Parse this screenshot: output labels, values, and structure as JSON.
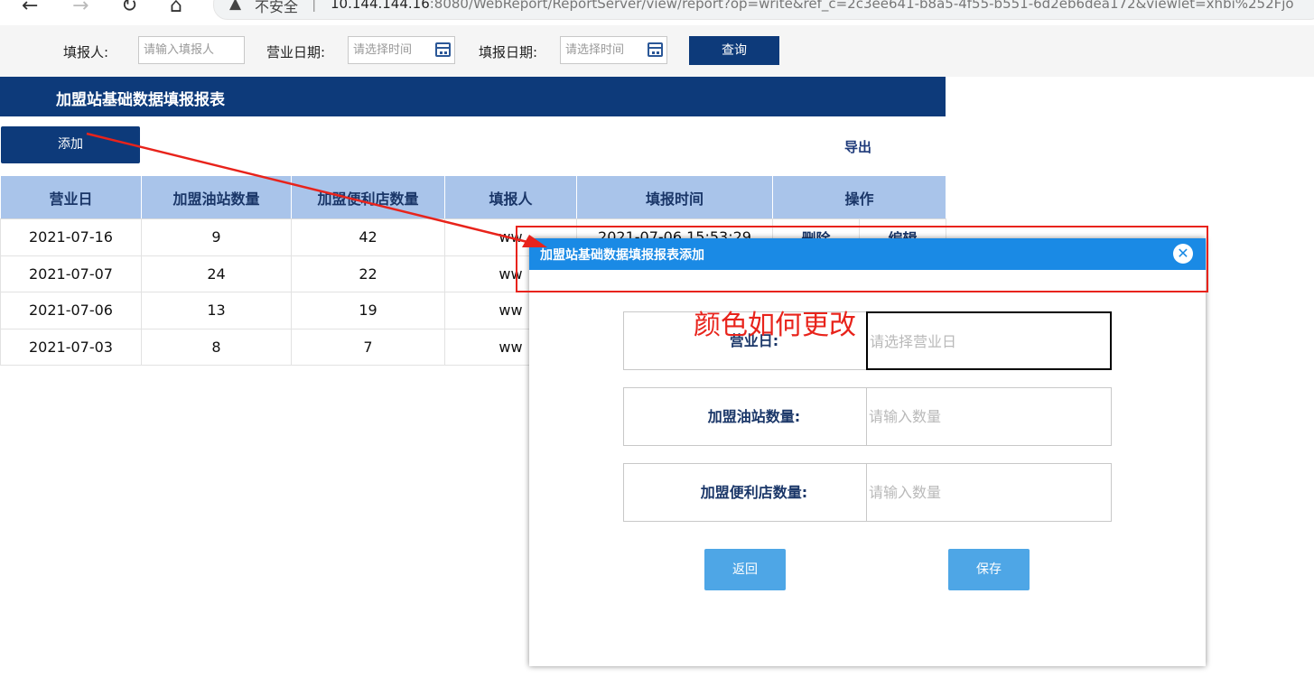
{
  "browser": {
    "back_icon": "←",
    "forward_icon": "→",
    "reload_icon": "↻",
    "home_icon": "⌂",
    "warning_icon": "▲",
    "insecure_label": "不安全",
    "separator": "|",
    "url_host": "10.144.144.16",
    "url_rest": ":8080/WebReport/ReportServer/view/report?op=write&ref_c=2c3ee641-b8a5-4f55-b551-6d2eb6dea172&viewlet=xhbi%252Fjo"
  },
  "filters": {
    "reporter_label": "填报人:",
    "reporter_placeholder": "请输入填报人",
    "business_date_label": "营业日期:",
    "business_date_placeholder": "请选择时间",
    "report_date_label": "填报日期:",
    "report_date_placeholder": "请选择时间",
    "query_label": "查询"
  },
  "report": {
    "title": "加盟站基础数据填报报表",
    "add_label": "添加",
    "export_label": "导出",
    "columns": [
      "营业日",
      "加盟油站数量",
      "加盟便利店数量",
      "填报人",
      "填报时间",
      "操作"
    ],
    "rows": [
      {
        "date": "2021-07-16",
        "stations": "9",
        "stores": "42",
        "reporter": "ww",
        "time": "2021-07-06 15:53:29",
        "delete": "删除",
        "edit": "编辑"
      },
      {
        "date": "2021-07-07",
        "stations": "24",
        "stores": "22",
        "reporter": "ww",
        "time": "",
        "delete": "",
        "edit": ""
      },
      {
        "date": "2021-07-06",
        "stations": "13",
        "stores": "19",
        "reporter": "ww",
        "time": "",
        "delete": "",
        "edit": ""
      },
      {
        "date": "2021-07-03",
        "stations": "8",
        "stores": "7",
        "reporter": "ww",
        "time": "",
        "delete": "",
        "edit": ""
      }
    ]
  },
  "dialog": {
    "title": "加盟站基础数据填报报表添加",
    "close_icon": "✕",
    "fields": [
      {
        "label": "营业日:",
        "placeholder": "请选择营业日"
      },
      {
        "label": "加盟油站数量:",
        "placeholder": "请输入数量"
      },
      {
        "label": "加盟便利店数量:",
        "placeholder": "请输入数量"
      }
    ],
    "back_label": "返回",
    "save_label": "保存"
  },
  "annotation": {
    "text": "颜色如何更改",
    "color": "#e8231b"
  },
  "colors": {
    "primary_navy": "#0d3a7a",
    "dialog_header_blue": "#1a8ae5",
    "table_header": "#a9c4ea",
    "dialog_button": "#4ea6e6"
  }
}
